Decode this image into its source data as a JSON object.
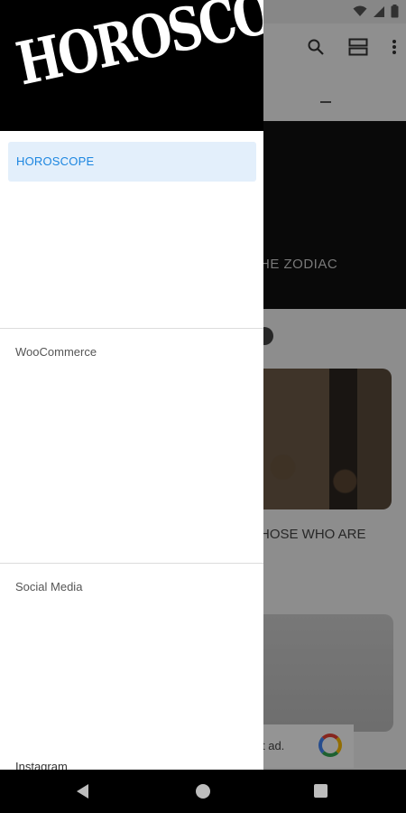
{
  "drawer": {
    "logo_text": "HOROSCOPE",
    "active_item": "HOROSCOPE",
    "sections": [
      "WooCommerce",
      "Social Media",
      "Instagram"
    ]
  },
  "background": {
    "hero_text": "HE ZODIAC",
    "card_text": "HOSE WHO ARE",
    "ad_text": "t ad."
  },
  "colors": {
    "accent": "#1c86e0",
    "active_bg": "#e3effb"
  },
  "icons": {
    "search": "search-icon",
    "view_toggle": "view-toggle-icon",
    "more": "more-vert-icon",
    "wifi": "wifi-icon",
    "signal": "signal-icon",
    "battery": "battery-icon",
    "back": "back-icon",
    "home": "home-icon",
    "recents": "recents-icon"
  }
}
